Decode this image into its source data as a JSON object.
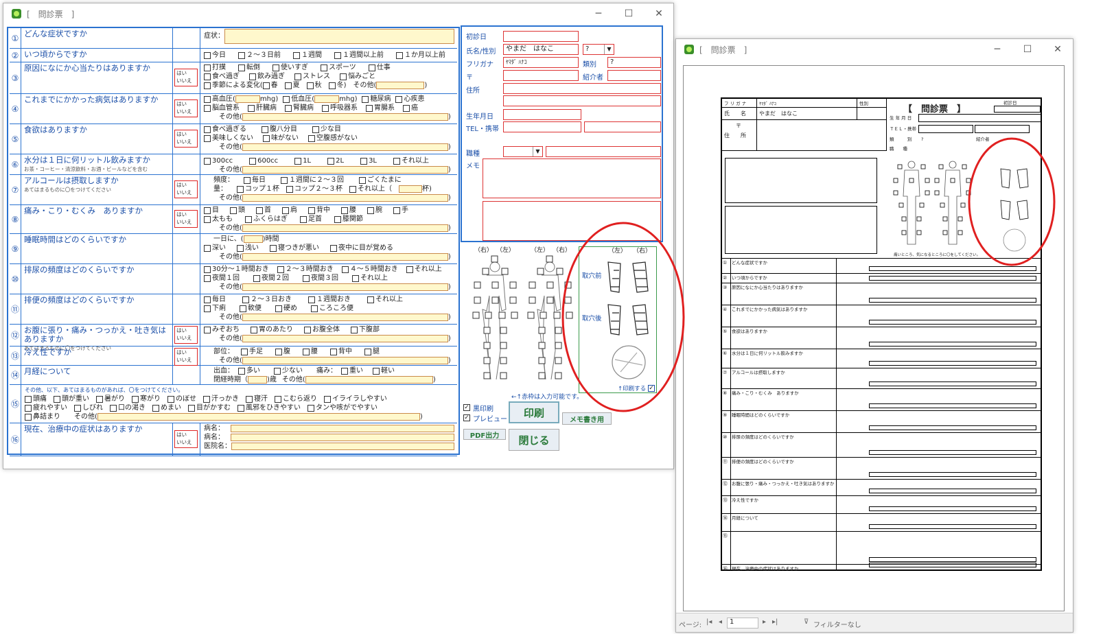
{
  "win1": {
    "title": "[　問診票　]",
    "min": "─",
    "max": "☐",
    "close": "✕"
  },
  "win2": {
    "title": "[　問診票　]",
    "min": "─",
    "max": "☐",
    "close": "✕"
  },
  "questions": [
    {
      "no": "①",
      "text": "どんな症状ですか",
      "sub": "",
      "yn": false
    },
    {
      "no": "②",
      "text": "いつ頃からですか",
      "sub": "",
      "yn": false
    },
    {
      "no": "③",
      "text": "原因になにか心当たりはありますか",
      "sub": "",
      "yn": true
    },
    {
      "no": "④",
      "text": "これまでにかかった病気はありますか",
      "sub": "",
      "yn": true
    },
    {
      "no": "⑤",
      "text": "食欲はありますか",
      "sub": "",
      "yn": true
    },
    {
      "no": "⑥",
      "text": "水分は１日に何リットル飲みますか",
      "sub": "お茶・コーヒー・清涼飲料・お酒・ビールなどを含む",
      "yn": false
    },
    {
      "no": "⑦",
      "text": "アルコールは摂取しますか",
      "sub": "あてはまるものに〇をつけてください",
      "yn": true
    },
    {
      "no": "⑧",
      "text": "痛み・こり・むくみ　ありますか",
      "sub": "",
      "yn": true
    },
    {
      "no": "⑨",
      "text": "睡眠時間はどのくらいですか",
      "sub": "",
      "yn": false
    },
    {
      "no": "⑩",
      "text": "排尿の頻度はどのくらいですか",
      "sub": "",
      "yn": false
    },
    {
      "no": "⑪",
      "text": "排便の頻度はどのくらいですか",
      "sub": "",
      "yn": false
    },
    {
      "no": "⑫",
      "text": "お腹に張り・痛み・つっかえ・吐き気はありますか",
      "sub": "あてはまるものに〇をつけてください",
      "yn": true
    },
    {
      "no": "⑬",
      "text": "冷え性ですか",
      "sub": "",
      "yn": true
    },
    {
      "no": "⑭",
      "text": "月経について",
      "sub": "",
      "yn": false
    },
    {
      "no": "⑮",
      "text": "",
      "sub": "",
      "yn": false
    },
    {
      "no": "⑯",
      "text": "現在、治療中の症状はありますか",
      "sub": "",
      "yn": true
    }
  ],
  "yn_label": {
    "a": "はい",
    "b": "いいえ"
  },
  "q1": {
    "label": "症状："
  },
  "q2": [
    "今日",
    "２〜３日前",
    "１週間",
    "１週間以上前",
    "１か月以上前"
  ],
  "q3": {
    "r1": [
      "打撲",
      "転倒",
      "使いすぎ",
      "スポーツ",
      "仕事"
    ],
    "r2": [
      "食べ過ぎ",
      "飲み過ぎ",
      "ストレス",
      "悩みごと"
    ],
    "r3a": "季節による変化(",
    "r3": [
      "春",
      "夏",
      "秋",
      "冬)"
    ],
    "other": "その他("
  },
  "q4": {
    "r1a": "高血圧(",
    "unit": "mhg)",
    "r1b": "低血圧(",
    "r1c": [
      "糖尿病",
      "心疾患"
    ],
    "r2": [
      "脳血管系",
      "肝臓病",
      "腎臓病",
      "呼吸器系",
      "胃腸系",
      "癌"
    ],
    "other": "その他("
  },
  "q5": {
    "r1": [
      "食べ過ぎる",
      "腹八分目",
      "少な目"
    ],
    "r2": [
      "美味しくない",
      "味がない",
      "空腹感がない"
    ],
    "other": "その他("
  },
  "q6": {
    "r1": [
      "300cc",
      "600cc",
      "1L",
      "2L",
      "3L",
      "それ以上"
    ],
    "other": "その他("
  },
  "q7": {
    "freq": "頻度：",
    "f": [
      "毎日",
      "１週間に２〜３回",
      "ごくたまに"
    ],
    "amt": "量：",
    "a": [
      "コップ１杯",
      "コップ２〜３杯",
      "それ以上（"
    ],
    "cup": "杯)",
    "other": "その他("
  },
  "q8": {
    "r1": [
      "目",
      "頭",
      "首",
      "肩",
      "背中",
      "腰",
      "腕",
      "手"
    ],
    "r2": [
      "太もも",
      "ふくらはぎ",
      "足首",
      "膝関節"
    ],
    "other": "その他("
  },
  "q9": {
    "r1a": "一日に、",
    "r1b": "時間",
    "r2": [
      "深い",
      "浅い",
      "寝つきが悪い",
      "夜中に目が覚める"
    ],
    "other": "その他("
  },
  "q10": {
    "r1": [
      "30分〜１時間おき",
      "２〜３時間おき",
      "４〜５時間おき",
      "それ以上"
    ],
    "r2": [
      "夜間１回",
      "夜間２回",
      "夜間３回",
      "それ以上"
    ],
    "other": "その他("
  },
  "q11": {
    "r1": [
      "毎日",
      "２〜３日おき",
      "１週間おき",
      "それ以上"
    ],
    "r2": [
      "下痢",
      "軟便",
      "硬め",
      "ころころ便"
    ],
    "other": "その他("
  },
  "q12": {
    "r1": [
      "みぞおち",
      "胃のあたり",
      "お腹全体",
      "下腹部"
    ],
    "other": "その他("
  },
  "q13": {
    "part": "部位：",
    "r1": [
      "手足",
      "腹",
      "腰",
      "背中",
      "腿"
    ],
    "other": "その他("
  },
  "q14": {
    "bleed": "出血：",
    "b": [
      "多い",
      "少ない"
    ],
    "pain": "痛み：",
    "p": [
      "重い",
      "軽い"
    ],
    "cycle": "閉経時期（",
    "age": ")歳",
    "other": "その他("
  },
  "q15": {
    "head": "その他、以下、あてはまるものがあれば、〇をつけてください。",
    "r1": [
      "頭痛",
      "頭が重い",
      "暑がり",
      "寒がり",
      "のぼせ",
      "汗っかき",
      "寝汗",
      "こむら返り",
      "イライラしやすい"
    ],
    "r2": [
      "疲れやすい",
      "しびれ",
      "口の渇き",
      "めまい",
      "目がかすむ",
      "風邪をひきやすい",
      "タンや咳がでやすい"
    ],
    "r3": [
      "鼻詰まり"
    ],
    "other": "その他("
  },
  "q16": {
    "l": [
      "病名：",
      "病名：",
      "医院名："
    ]
  },
  "info": {
    "first": "初診日",
    "name": "氏名/性別",
    "name_val": "やまだ　はなこ",
    "sex_val": "?",
    "kana": "フリガナ",
    "kana_val": "ﾔﾏﾀﾞ ﾊﾅｺ",
    "kind": "類別",
    "kind_val": "?",
    "zip": "〒",
    "intro": "紹介者",
    "addr": "住所",
    "birth": "生年月日",
    "tel": "TEL・携帯",
    "job": "職種",
    "memo": "メモ"
  },
  "body": {
    "rl1": "（右）",
    "ll1": "（左）",
    "ll2": "（左）",
    "rl2": "（右）",
    "bl": "（左）",
    "br": "（右）",
    "before": "取穴前",
    "after": "取穴後",
    "print": "↑印刷する",
    "note": "←↑赤枠は入力可能です。"
  },
  "controls": {
    "black": "黒印刷",
    "preview": "プレビュー",
    "print": "印刷",
    "memo": "メモ書き用",
    "pdf": "PDF出力",
    "close": "閉じる"
  },
  "preview": {
    "title": "【　問診票　】",
    "kana": "フ リ ガ ナ",
    "kana_val": "ﾔﾏﾀﾞ ﾊﾅｺ",
    "sex": "性別",
    "name": "氏　　名",
    "name_val": "やまだ　はなこ",
    "zip": "〒",
    "addr": "住　　所",
    "birth": "生 年 月 日",
    "tel": "ＴＥＬ・携帯",
    "kind": "類　　　別",
    "kind_val": "?",
    "intro": "紹介者",
    "job": "職　　種",
    "first": "初診日",
    "body_note": "痛いところ、気になるところに〇をしてください。",
    "page_label": "ページ:",
    "page": "1",
    "filter": "フィルターなし",
    "yn": "(はい・いいえ)"
  }
}
